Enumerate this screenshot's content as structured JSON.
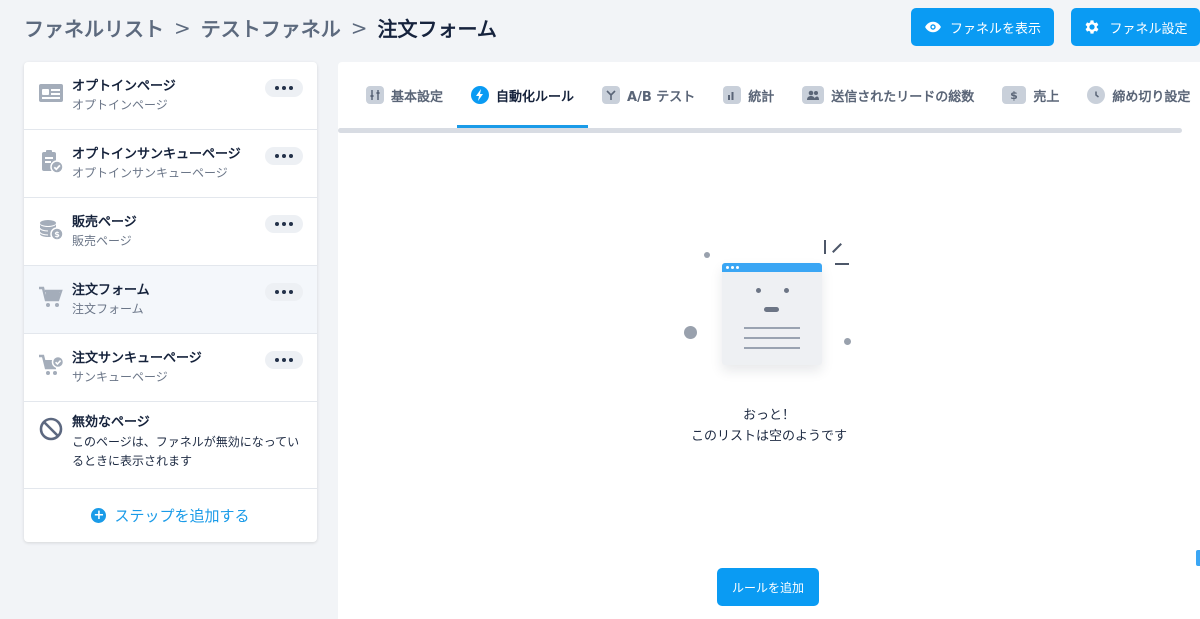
{
  "breadcrumb": {
    "items": [
      "ファネルリスト",
      "テストファネル"
    ],
    "current": "注文フォーム",
    "separator": ">"
  },
  "header": {
    "view_button": "ファネルを表示",
    "settings_button": "ファネル設定"
  },
  "sidebar": {
    "steps": [
      {
        "title": "オプトインページ",
        "subtitle": "オプトインページ",
        "icon": "optin-page-icon"
      },
      {
        "title": "オプトインサンキューページ",
        "subtitle": "オプトインサンキューページ",
        "icon": "clipboard-check-icon"
      },
      {
        "title": "販売ページ",
        "subtitle": "販売ページ",
        "icon": "coins-icon"
      },
      {
        "title": "注文フォーム",
        "subtitle": "注文フォーム",
        "icon": "cart-icon",
        "active": true
      },
      {
        "title": "注文サンキューページ",
        "subtitle": "サンキューページ",
        "icon": "cart-check-icon"
      }
    ],
    "disabled": {
      "title": "無効なページ",
      "description": "このページは、ファネルが無効になっているときに表示されます"
    },
    "add_step": "ステップを追加する"
  },
  "tabs": [
    {
      "label": "基本設定",
      "icon": "sliders-icon"
    },
    {
      "label": "自動化ルール",
      "icon": "lightning-icon",
      "active": true
    },
    {
      "label": "A/B テスト",
      "icon": "split-icon"
    },
    {
      "label": "統計",
      "icon": "bar-chart-icon"
    },
    {
      "label": "送信されたリードの総数",
      "icon": "users-icon"
    },
    {
      "label": "売上",
      "icon": "dollar-icon"
    },
    {
      "label": "締め切り設定",
      "icon": "clock-icon"
    }
  ],
  "empty_state": {
    "line1": "おっと！",
    "line2": "このリストは空のようです"
  },
  "add_rule_button": "ルールを追加",
  "colors": {
    "accent": "#0a9bf3",
    "background": "#f2f4f7",
    "text_dark": "#15223b"
  }
}
